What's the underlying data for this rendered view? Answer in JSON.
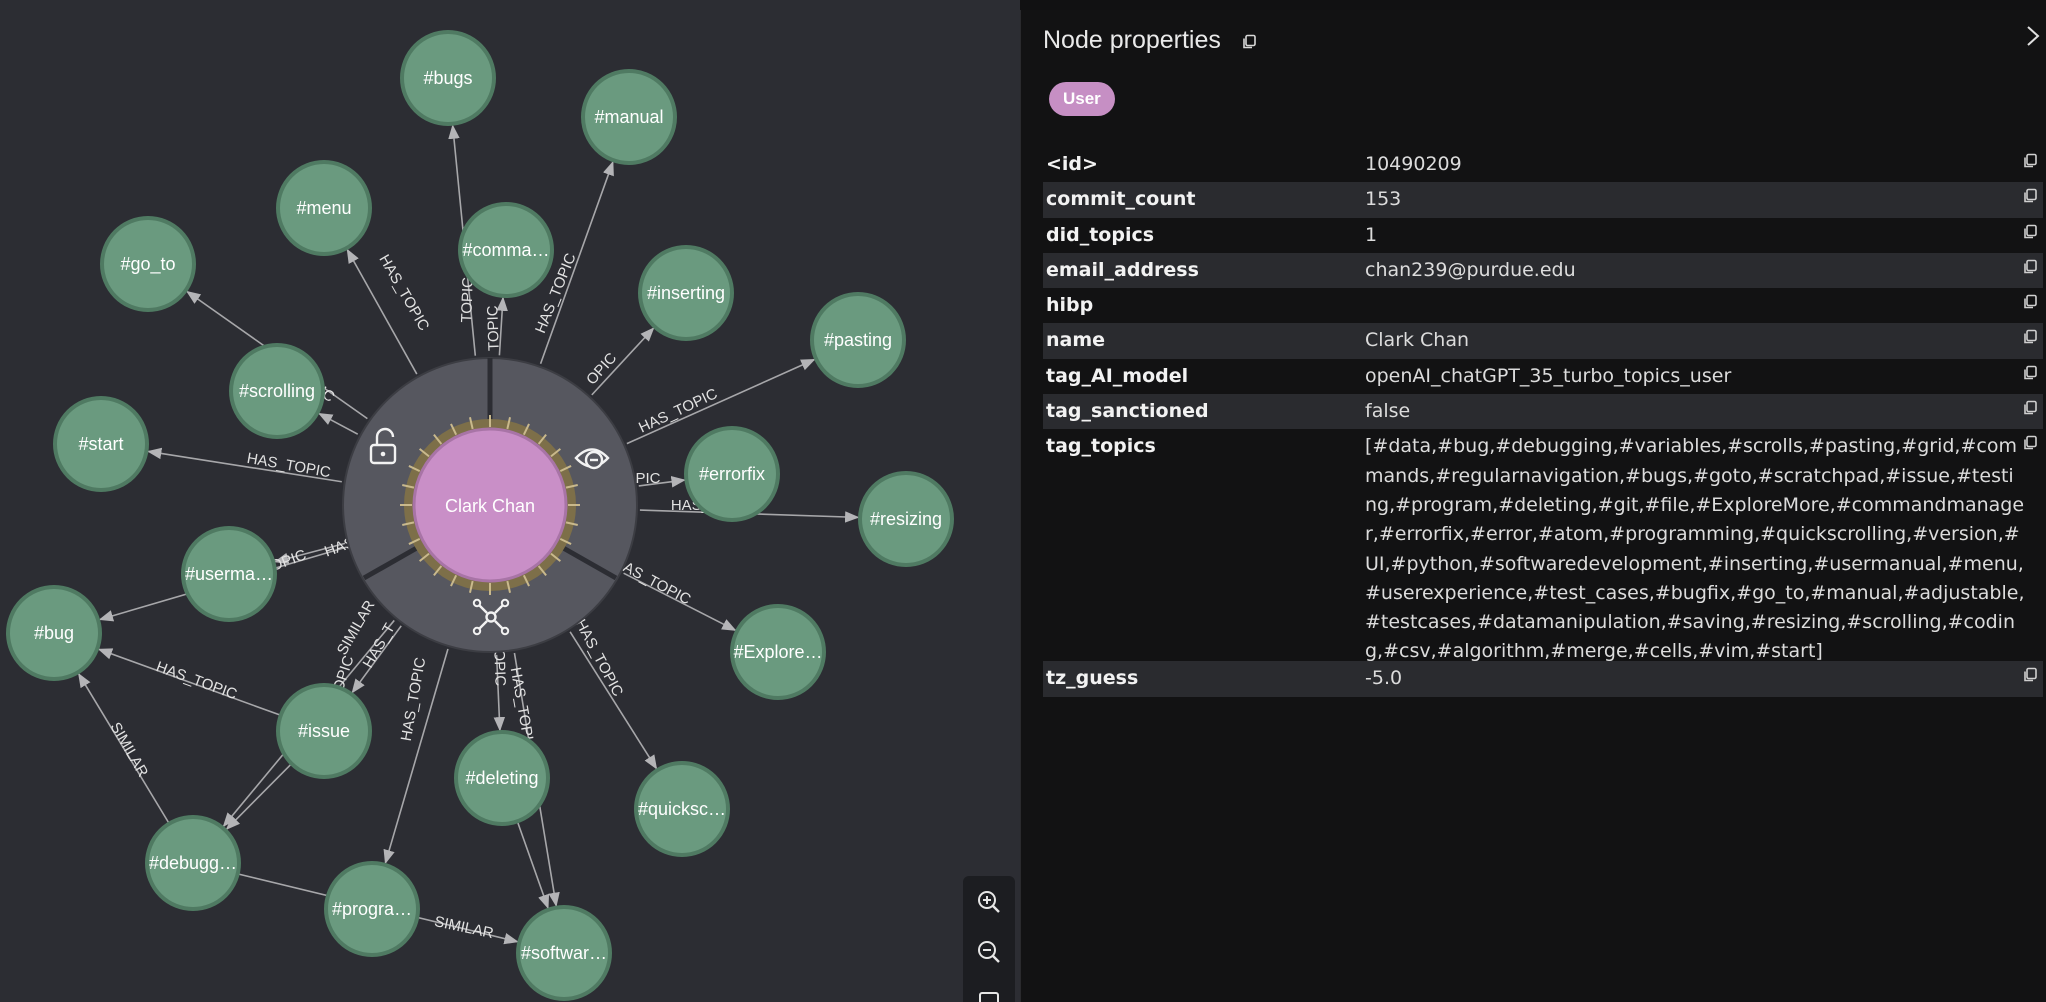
{
  "graph": {
    "center_label": "Clark Chan",
    "ring_actions": [
      {
        "name": "unlock-icon"
      },
      {
        "name": "hide-icon"
      },
      {
        "name": "expand-icon"
      }
    ],
    "nodes": [
      {
        "id": "bugs",
        "label": "#bugs"
      },
      {
        "id": "manual",
        "label": "#manual"
      },
      {
        "id": "menu",
        "label": "#menu"
      },
      {
        "id": "comma",
        "label": "#comma…"
      },
      {
        "id": "goto",
        "label": "#go_to"
      },
      {
        "id": "inserting",
        "label": "#inserting"
      },
      {
        "id": "pasting",
        "label": "#pasting"
      },
      {
        "id": "scrolling",
        "label": "#scrolling"
      },
      {
        "id": "start",
        "label": "#start"
      },
      {
        "id": "errorfix",
        "label": "#errorfix"
      },
      {
        "id": "resizing",
        "label": "#resizing"
      },
      {
        "id": "userma",
        "label": "#userma…"
      },
      {
        "id": "bug",
        "label": "#bug"
      },
      {
        "id": "explore",
        "label": "#Explore…"
      },
      {
        "id": "issue",
        "label": "#issue"
      },
      {
        "id": "deleting",
        "label": "#deleting"
      },
      {
        "id": "quicksc",
        "label": "#quicksc…"
      },
      {
        "id": "debugg",
        "label": "#debugg…"
      },
      {
        "id": "progra",
        "label": "#progra…"
      },
      {
        "id": "softwar",
        "label": "#softwar…"
      }
    ],
    "edge_labels": {
      "has_topic": "HAS_TOPIC",
      "similar": "SIMILAR",
      "fragments": [
        "TOPIC",
        "TOPIC",
        "HAS_TOPIC",
        "OPIC",
        "HAS_TOPIC",
        "PIC",
        "HAS_T",
        "HAS_TOPIC",
        "HAS_TOPIC",
        "HAS_TOPIC",
        "PIC",
        "HAS_TOPIC",
        "HAS_",
        "OPIC",
        "HAS_TOPIC",
        "OPIC",
        "HAS_TOPIC",
        "OPIC",
        "HAS_T",
        "HAS_TOPIC",
        "SIMILAR",
        "SIMILAR",
        "SIMILAR"
      ]
    }
  },
  "zoom": {
    "zoom_in_icon": "zoom-in-icon",
    "zoom_out_icon": "zoom-out-icon",
    "fit_icon": "fit-to-screen-icon"
  },
  "panel": {
    "title": "Node properties",
    "label_badge": "User",
    "properties": [
      {
        "key": "<id>",
        "value": "10490209"
      },
      {
        "key": "commit_count",
        "value": "153"
      },
      {
        "key": "did_topics",
        "value": "1"
      },
      {
        "key": "email_address",
        "value": "chan239@purdue.edu"
      },
      {
        "key": "hibp",
        "value": ""
      },
      {
        "key": "name",
        "value": "Clark Chan"
      },
      {
        "key": "tag_AI_model",
        "value": "openAI_chatGPT_35_turbo_topics_user"
      },
      {
        "key": "tag_sanctioned",
        "value": "false"
      },
      {
        "key": "tag_topics",
        "value": "[#data,#bug,#debugging,#variables,#scrolls,#pasting,#grid,#commands,#regularnavigation,#bugs,#goto,#scratchpad,#issue,#testing,#program,#deleting,#git,#file,#ExploreMore,#commandmanager,#errorfix,#error,#atom,#programming,#quickscrolling,#version,#UI,#python,#softwaredevelopment,#inserting,#usermanual,#menu,#userexperience,#test_cases,#bugfix,#go_to,#manual,#adjustable,#testcases,#datamanipulation,#saving,#resizing,#scrolling,#coding,#csv,#algorithm,#merge,#cells,#vim,#start]"
      },
      {
        "key": "tz_guess",
        "value": "-5.0"
      }
    ]
  },
  "colors": {
    "canvas_bg": "#2c2d33",
    "panel_bg": "#121213",
    "topic_node": "#6a9a7f",
    "topic_node_stroke": "#4f7a62",
    "user_node": "#c98fc7",
    "ring": "#55565f",
    "edge": "#a7a7aa",
    "row_shade": "#2a2b2f"
  }
}
